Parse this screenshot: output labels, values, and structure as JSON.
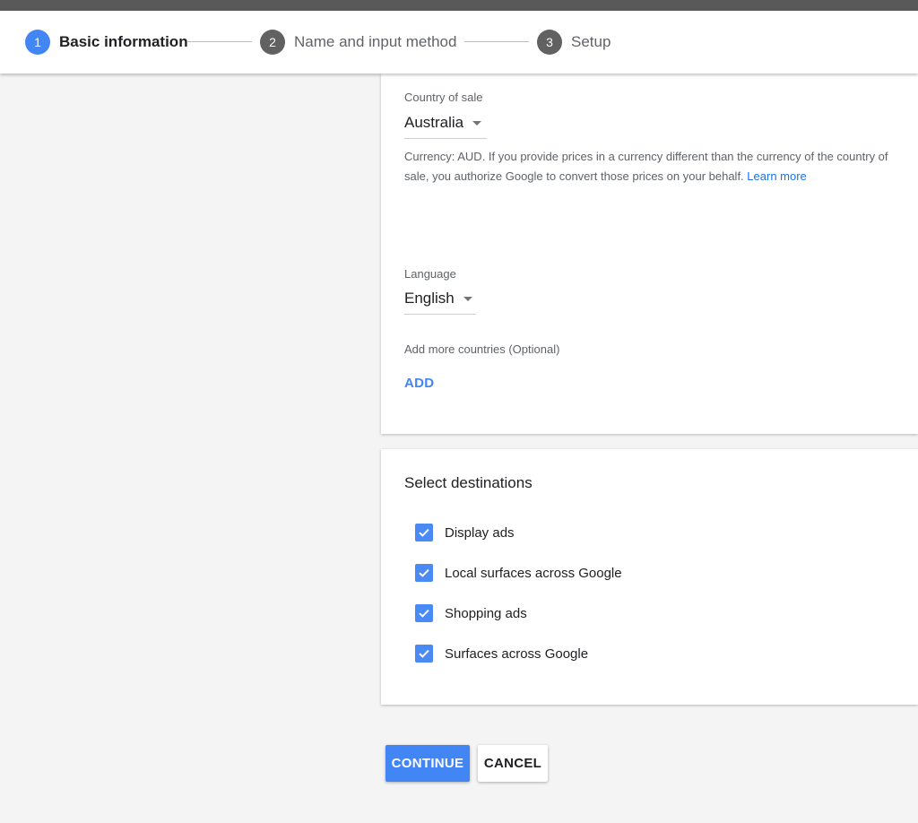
{
  "stepper": {
    "steps": [
      {
        "number": "1",
        "label": "Basic information",
        "state": "active"
      },
      {
        "number": "2",
        "label": "Name and input method",
        "state": "inactive"
      },
      {
        "number": "3",
        "label": "Setup",
        "state": "inactive"
      }
    ]
  },
  "country_card": {
    "country_label": "Country of sale",
    "country_value": "Australia",
    "currency_help": "Currency: AUD. If you provide prices in a currency different than the currency of the country of sale, you authorize Google to convert those prices on your behalf.",
    "learn_more": "Learn more",
    "language_label": "Language",
    "language_value": "English",
    "more_countries_label": "Add more countries (Optional)",
    "add_button": "ADD"
  },
  "destinations_card": {
    "title": "Select destinations",
    "options": [
      {
        "label": "Display ads",
        "checked": true
      },
      {
        "label": "Local surfaces across Google",
        "checked": true
      },
      {
        "label": "Shopping ads",
        "checked": true
      },
      {
        "label": "Surfaces across Google",
        "checked": true
      }
    ]
  },
  "actions": {
    "continue": "CONTINUE",
    "cancel": "CANCEL"
  },
  "colors": {
    "accent": "#4285f4",
    "step_inactive": "#5f6368",
    "checkbox": "#4a8af4",
    "link": "#1a73e8"
  },
  "icons": {
    "dropdown": "caret-down-icon",
    "checkbox": "checkmark-icon"
  }
}
